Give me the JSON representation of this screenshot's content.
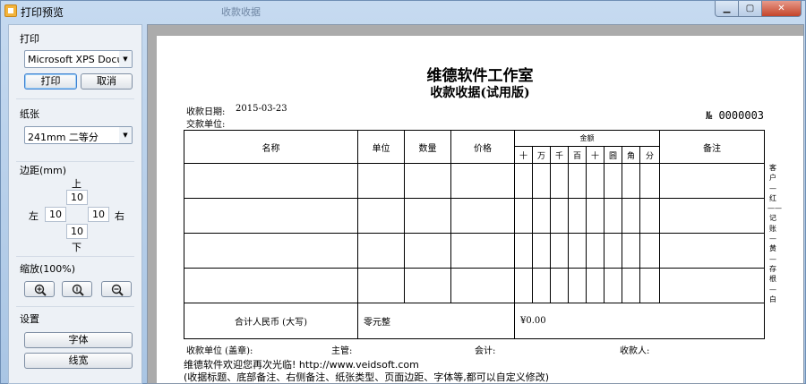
{
  "window": {
    "title": "打印预览",
    "ghost_title": "收款收据"
  },
  "sidebar": {
    "print": {
      "label": "打印",
      "printer": "Microsoft XPS Document Writer",
      "print_button": "打印",
      "cancel_button": "取消"
    },
    "paper": {
      "label": "纸张",
      "size": "241mm 二等分"
    },
    "margin": {
      "label": "边距(mm)",
      "top_label": "上",
      "top": "10",
      "left_label": "左",
      "left": "10",
      "right": "10",
      "right_label": "右",
      "bottom": "10",
      "bottom_label": "下"
    },
    "zoom": {
      "label": "缩放(100%)",
      "zoom_in_icon": "zoom-in-icon",
      "zoom_reset_icon": "zoom-reset-icon",
      "zoom_out_icon": "zoom-out-icon"
    },
    "settings": {
      "label": "设置",
      "font_button": "字体",
      "line_width_button": "线宽"
    }
  },
  "document": {
    "company": "维德软件工作室",
    "title": "收款收据(试用版)",
    "date_label": "收款日期:",
    "date": "2015-03-23",
    "payer_label": "交款单位:",
    "number": "№ 0000003",
    "headers": {
      "name": "名称",
      "unit": "单位",
      "quantity": "数量",
      "price": "价格",
      "amount": "金额",
      "remark": "备注"
    },
    "amount_digits": [
      "十",
      "万",
      "千",
      "百",
      "十",
      "圆",
      "角",
      "分"
    ],
    "empty_rows": 4,
    "total_label": "合计人民币 (大写)",
    "total_words": "零元整",
    "total_amount": "¥0.00",
    "side_note": "客户—红——记账—黄—存根—白",
    "signatures": {
      "receiver_unit": "收款单位 (盖章):",
      "supervisor": "主管:",
      "accountant": "会计:",
      "cashier": "收款人:"
    },
    "footer_line1": "维德软件欢迎您再次光临!  http://www.veidsoft.com",
    "footer_line2": "(收据标题、底部备注、右侧备注、纸张类型、页面边距、字体等,都可以自定义修改)"
  }
}
